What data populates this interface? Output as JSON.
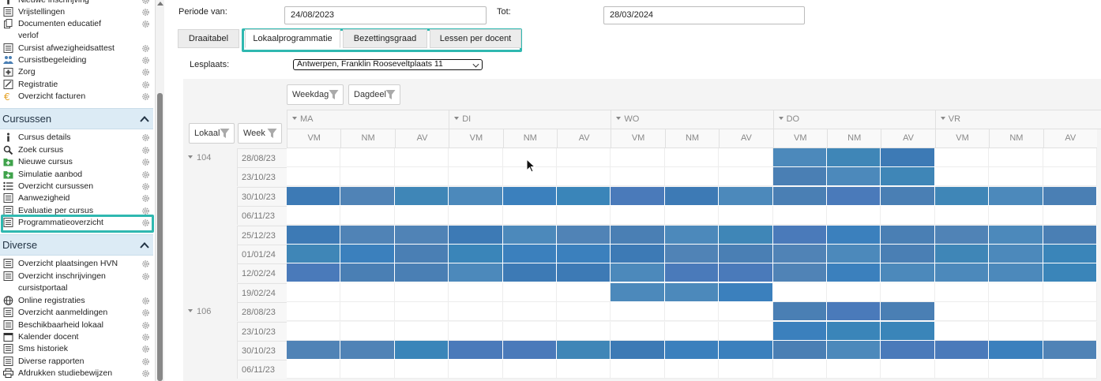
{
  "sidebar": {
    "top_items": [
      {
        "label": "Nieuwe inschrijving",
        "icon": "info-icon"
      },
      {
        "label": "Vrijstellingen",
        "icon": "list-icon"
      },
      {
        "label": "Documenten educatief",
        "label2": "verlof",
        "icon": "documents-icon"
      },
      {
        "label": "Cursist afwezigheidsattest",
        "icon": "list-icon"
      },
      {
        "label": "Cursistbegeleiding",
        "icon": "people-icon"
      },
      {
        "label": "Zorg",
        "icon": "first-aid-icon"
      },
      {
        "label": "Registratie",
        "icon": "edit-icon"
      },
      {
        "label": "Overzicht facturen",
        "icon": "euro-icon"
      }
    ],
    "sections": [
      {
        "title": "Cursussen",
        "items": [
          {
            "label": "Cursus details",
            "icon": "info-icon"
          },
          {
            "label": "Zoek cursus",
            "icon": "search-icon"
          },
          {
            "label": "Nieuwe cursus",
            "icon": "folder-add-icon"
          },
          {
            "label": "Simulatie aanbod",
            "icon": "folder-add-icon"
          },
          {
            "label": "Overzicht cursussen",
            "icon": "bullet-list-icon"
          },
          {
            "label": "Aanwezigheid",
            "icon": "list-icon"
          },
          {
            "label": "Evaluatie per cursus",
            "icon": "list-icon"
          },
          {
            "label": "Programmatieoverzicht",
            "icon": "list-icon"
          }
        ]
      },
      {
        "title": "Diverse",
        "items": [
          {
            "label": "Overzicht plaatsingen HVN",
            "icon": "list-icon"
          },
          {
            "label": "Overzicht inschrijvingen",
            "label2": "cursistportaal",
            "icon": "list-icon"
          },
          {
            "label": "Online registraties",
            "icon": "globe-icon"
          },
          {
            "label": "Overzicht aanmeldingen",
            "icon": "list-icon"
          },
          {
            "label": "Beschikbaarheid lokaal",
            "icon": "list-icon"
          },
          {
            "label": "Kalender docent",
            "icon": "calendar-icon"
          },
          {
            "label": "Sms historiek",
            "icon": "list-icon"
          },
          {
            "label": "Diverse rapporten",
            "icon": "list-icon"
          },
          {
            "label": "Afdrukken studiebewijzen",
            "icon": "printer-icon"
          }
        ]
      }
    ]
  },
  "filters": {
    "periode_van_label": "Periode van:",
    "periode_van_value": "24/08/2023",
    "tot_label": "Tot:",
    "tot_value": "28/03/2024",
    "lesplaats_label": "Lesplaats:",
    "lesplaats_value": "Antwerpen, Franklin Rooseveltplaats 11"
  },
  "tabs": [
    "Draaitabel",
    "Lokaalprogrammatie",
    "Bezettingsgraad",
    "Lessen per docent"
  ],
  "active_tab": "Lokaalprogrammatie",
  "pivot": {
    "col_chips": [
      "Weekdag",
      "Dagdeel"
    ],
    "row_chips": [
      "Lokaal",
      "Week"
    ],
    "days": [
      "MA",
      "DI",
      "WO",
      "DO",
      "VR"
    ],
    "parts": [
      "VM",
      "NM",
      "AV"
    ],
    "groups": [
      {
        "lokaal": "104",
        "rows": [
          {
            "week": "28/08/23",
            "filled": [
              0,
              0,
              0,
              0,
              0,
              0,
              0,
              0,
              0,
              1,
              1,
              1,
              0,
              0,
              0
            ]
          },
          {
            "week": "23/10/23",
            "filled": [
              0,
              0,
              0,
              0,
              0,
              0,
              0,
              0,
              0,
              1,
              1,
              1,
              0,
              0,
              0
            ]
          },
          {
            "week": "30/10/23",
            "filled": [
              1,
              1,
              1,
              1,
              1,
              1,
              1,
              1,
              1,
              1,
              1,
              1,
              1,
              1,
              1
            ]
          },
          {
            "week": "06/11/23",
            "filled": [
              0,
              0,
              0,
              0,
              0,
              0,
              0,
              0,
              0,
              0,
              0,
              0,
              0,
              0,
              0
            ]
          },
          {
            "week": "25/12/23",
            "filled": [
              1,
              1,
              1,
              1,
              1,
              1,
              1,
              1,
              1,
              1,
              1,
              1,
              1,
              1,
              1
            ]
          },
          {
            "week": "01/01/24",
            "filled": [
              1,
              1,
              1,
              1,
              1,
              1,
              1,
              1,
              1,
              1,
              1,
              1,
              1,
              1,
              1
            ]
          },
          {
            "week": "12/02/24",
            "filled": [
              1,
              1,
              1,
              1,
              1,
              1,
              1,
              1,
              1,
              1,
              1,
              1,
              1,
              1,
              1
            ]
          },
          {
            "week": "19/02/24",
            "filled": [
              0,
              0,
              0,
              0,
              0,
              0,
              1,
              1,
              1,
              0,
              0,
              0,
              0,
              0,
              0
            ]
          }
        ]
      },
      {
        "lokaal": "106",
        "rows": [
          {
            "week": "28/08/23",
            "filled": [
              0,
              0,
              0,
              0,
              0,
              0,
              0,
              0,
              0,
              1,
              1,
              1,
              0,
              0,
              0
            ]
          },
          {
            "week": "23/10/23",
            "filled": [
              0,
              0,
              0,
              0,
              0,
              0,
              0,
              0,
              0,
              1,
              1,
              1,
              0,
              0,
              0
            ]
          },
          {
            "week": "30/10/23",
            "filled": [
              1,
              1,
              1,
              1,
              1,
              1,
              1,
              1,
              1,
              1,
              1,
              1,
              1,
              1,
              1
            ]
          },
          {
            "week": "06/11/23",
            "filled": [
              0,
              0,
              0,
              0,
              0,
              0,
              0,
              0,
              0,
              0,
              0,
              0,
              0,
              0,
              0
            ]
          }
        ]
      }
    ]
  },
  "colors": {
    "accent_highlight": "#2fb8b0",
    "section_bg": "#dcebf5",
    "cell_palette": [
      "#3d7ab5",
      "#4a7fb4",
      "#3b80bd",
      "#4c89bb",
      "#3f86b7",
      "#4a7aba",
      "#3a85b9",
      "#5083b6"
    ]
  }
}
